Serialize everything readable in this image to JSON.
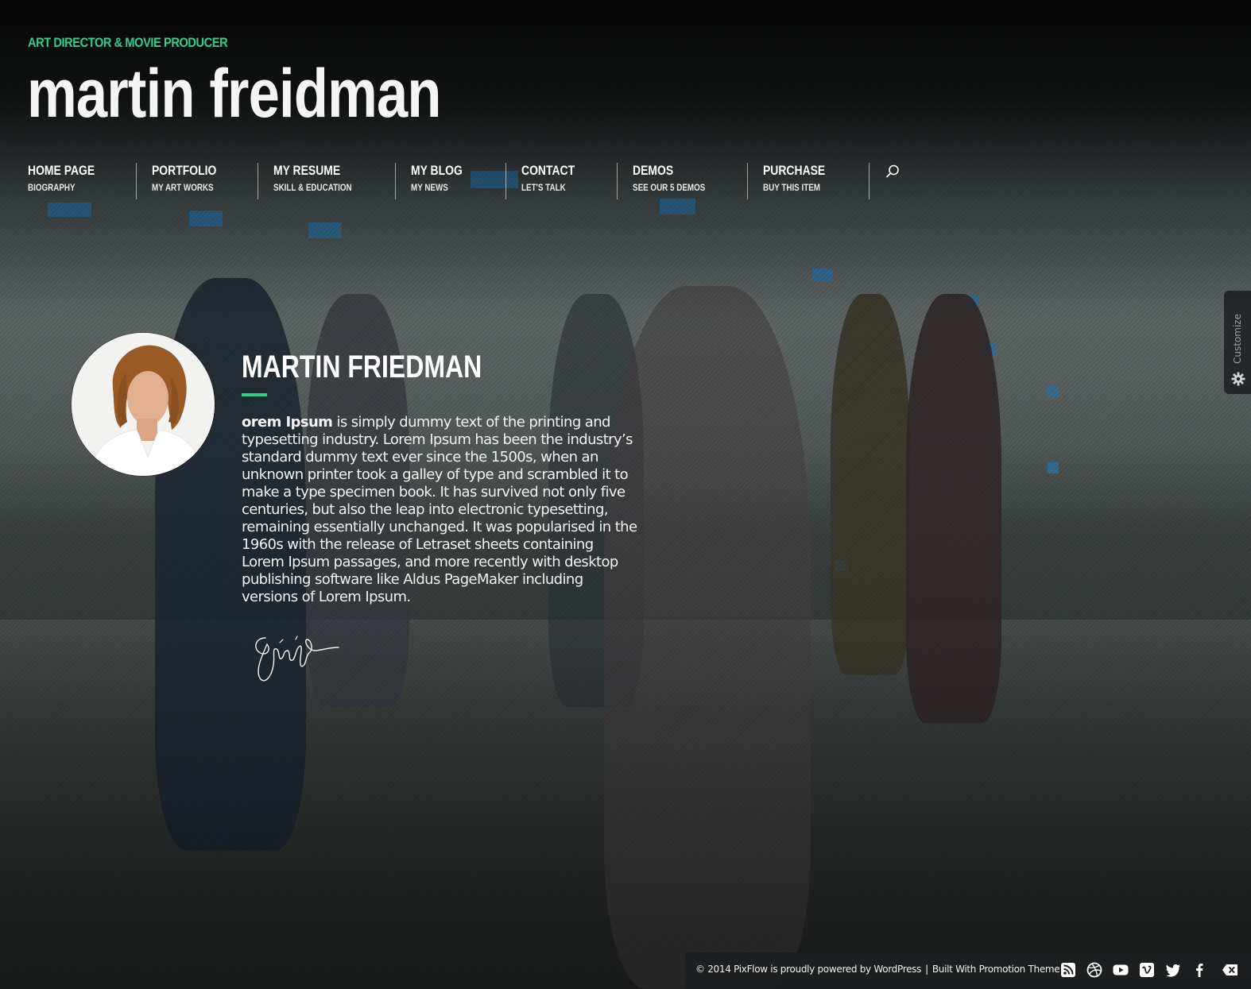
{
  "header": {
    "tagline": "ART DIRECTOR & MOVIE PRODUCER",
    "site_title": "martin freidman"
  },
  "nav": {
    "items": [
      {
        "title": "HOME PAGE",
        "subtitle": "BIOGRAPHY"
      },
      {
        "title": "PORTFOLIO",
        "subtitle": "MY ART WORKS"
      },
      {
        "title": "MY RESUME",
        "subtitle": "SKILL & EDUCATION"
      },
      {
        "title": "MY BLOG",
        "subtitle": "MY NEWS"
      },
      {
        "title": "CONTACT",
        "subtitle": "LET'S TALK"
      },
      {
        "title": "DEMOS",
        "subtitle": "SEE OUR 5 DEMOS"
      },
      {
        "title": "PURCHASE",
        "subtitle": "BUY THIS ITEM"
      }
    ],
    "search_icon": "search-icon"
  },
  "bio": {
    "name": "MARTIN FRIEDMAN",
    "text_lead": "orem Ipsum",
    "text_body": " is simply dummy text of the printing and typesetting industry. Lorem Ipsum has been the industry’s standard dummy text ever since the 1500s, when an unknown printer took a galley of type and scrambled it to make a type specimen book. It has survived not only five centuries, but also the leap into electronic typesetting, remaining essentially unchanged. It was popularised in the 1960s with the release of Letraset sheets containing Lorem Ipsum passages, and more recently with desktop publishing software like Aldus PageMaker including versions of Lorem Ipsum."
  },
  "customize": {
    "label": "Customize",
    "icon": "gear-icon"
  },
  "footer": {
    "copyright": "© 2014 PixFlow is proudly powered by WordPress",
    "separator": "|",
    "built_with": "Built With Promotion Theme",
    "social_icons": [
      "rss-icon",
      "dribbble-icon",
      "youtube-icon",
      "vimeo-icon",
      "twitter-icon",
      "facebook-icon",
      "close-icon"
    ]
  },
  "colors": {
    "accent": "#2fcf8e",
    "text": "#ffffff",
    "footer_bg": "#1c1e1f"
  }
}
